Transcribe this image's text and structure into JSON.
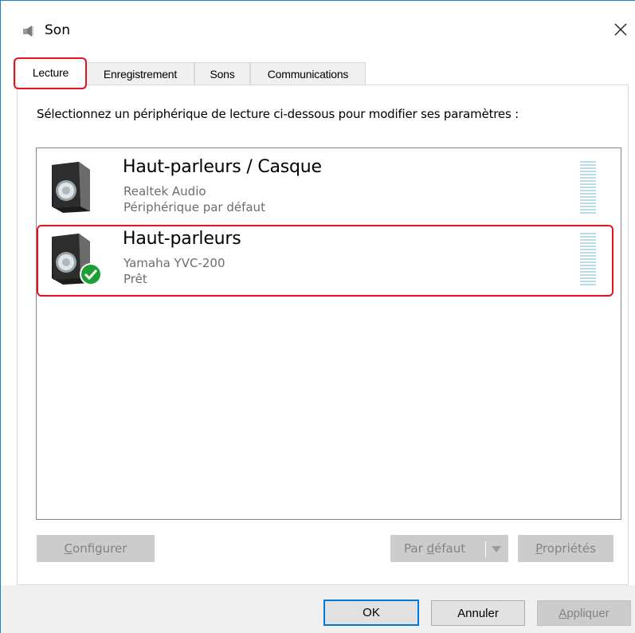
{
  "window": {
    "title": "Son",
    "close_glyph": "✕"
  },
  "tabs": [
    {
      "label": "Lecture",
      "active": true
    },
    {
      "label": "Enregistrement",
      "active": false
    },
    {
      "label": "Sons",
      "active": false
    },
    {
      "label": "Communications",
      "active": false
    }
  ],
  "instruction": "Sélectionnez un périphérique de lecture ci-dessous pour modifier ses paramètres :",
  "devices": [
    {
      "name": "Haut-parleurs / Casque",
      "driver": "Realtek Audio",
      "status": "Périphérique par défaut",
      "icon": "speaker-icon",
      "is_default": false
    },
    {
      "name": "Haut-parleurs",
      "driver": "Yamaha YVC-200",
      "status": "Prêt",
      "icon": "speaker-icon",
      "is_default": true
    }
  ],
  "buttons": {
    "configure": {
      "label": "onfigurer",
      "mnemonic": "C"
    },
    "set_default": {
      "label_pre": "Par ",
      "mnemonic": "d",
      "label_post": "éfaut"
    },
    "properties": {
      "label": "ropriétés",
      "mnemonic": "P"
    },
    "ok": "OK",
    "cancel": "Annuler",
    "apply": {
      "label": "ppliquer",
      "mnemonic": "A"
    }
  },
  "colors": {
    "accent": "#1883d7",
    "highlight": "#e3141e",
    "check": "#1e9e36",
    "meter": "#b9dbe9"
  }
}
